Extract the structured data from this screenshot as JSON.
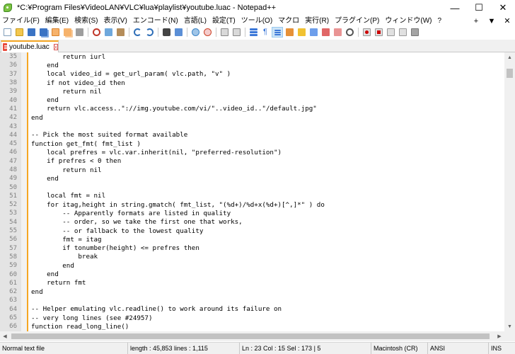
{
  "window": {
    "title": "*C:¥Program Files¥VideoLAN¥VLC¥lua¥playlist¥youtube.luac - Notepad++",
    "minimize_glyph": "—",
    "maximize_glyph": "☐",
    "close_glyph": "✕"
  },
  "menu": {
    "items": [
      "ファイル(F)",
      "編集(E)",
      "検索(S)",
      "表示(V)",
      "エンコード(N)",
      "言語(L)",
      "設定(T)",
      "ツール(O)",
      "マクロ",
      "実行(R)",
      "プラグイン(P)",
      "ウィンドウ(W)",
      "?"
    ],
    "right_plus": "+",
    "right_dropdown": "▼",
    "right_close": "✕"
  },
  "toolbar": {
    "icons": [
      "new-file-icon",
      "open-file-icon",
      "save-icon",
      "save-all-icon",
      "close-icon",
      "close-all-icon",
      "print-icon",
      "cut-icon",
      "copy-icon",
      "paste-icon",
      "undo-icon",
      "redo-icon",
      "find-icon",
      "replace-icon",
      "zoom-in-icon",
      "zoom-out-icon",
      "sync-vertical-icon",
      "sync-horizontal-icon",
      "word-wrap-icon",
      "show-all-chars-icon",
      "indent-guide-icon",
      "user-defined-language-icon",
      "doc-map-icon",
      "function-list-icon",
      "folder-as-workspace-icon",
      "doc-switcher-icon",
      "monitoring-icon",
      "record-macro-icon",
      "stop-record-icon",
      "play-macro-icon",
      "run-macro-multiple-icon",
      "save-macro-icon"
    ]
  },
  "tab": {
    "label": "youtube.luac",
    "close_glyph": "x"
  },
  "editor": {
    "lines": [
      {
        "n": "35",
        "t": "        return iurl"
      },
      {
        "n": "36",
        "t": "    end"
      },
      {
        "n": "37",
        "t": "    local video_id = get_url_param( vlc.path, \"v\" )"
      },
      {
        "n": "38",
        "t": "    if not video_id then"
      },
      {
        "n": "39",
        "t": "        return nil"
      },
      {
        "n": "40",
        "t": "    end"
      },
      {
        "n": "41",
        "t": "    return vlc.access..\"://img.youtube.com/vi/\"..video_id..\"/default.jpg\""
      },
      {
        "n": "42",
        "t": "end"
      },
      {
        "n": "43",
        "t": ""
      },
      {
        "n": "44",
        "t": "-- Pick the most suited format available"
      },
      {
        "n": "45",
        "t": "function get_fmt( fmt_list )"
      },
      {
        "n": "46",
        "t": "    local prefres = vlc.var.inherit(nil, \"preferred-resolution\")"
      },
      {
        "n": "47",
        "t": "    if prefres < 0 then"
      },
      {
        "n": "48",
        "t": "        return nil"
      },
      {
        "n": "49",
        "t": "    end"
      },
      {
        "n": "50",
        "t": ""
      },
      {
        "n": "51",
        "t": "    local fmt = nil"
      },
      {
        "n": "52",
        "t": "    for itag,height in string.gmatch( fmt_list, \"(%d+)/%d+x(%d+)[^,]*\" ) do"
      },
      {
        "n": "53",
        "t": "        -- Apparently formats are listed in quality"
      },
      {
        "n": "54",
        "t": "        -- order, so we take the first one that works,"
      },
      {
        "n": "55",
        "t": "        -- or fallback to the lowest quality"
      },
      {
        "n": "56",
        "t": "        fmt = itag"
      },
      {
        "n": "57",
        "t": "        if tonumber(height) <= prefres then"
      },
      {
        "n": "58",
        "t": "            break"
      },
      {
        "n": "59",
        "t": "        end"
      },
      {
        "n": "60",
        "t": "    end"
      },
      {
        "n": "61",
        "t": "    return fmt"
      },
      {
        "n": "62",
        "t": "end"
      },
      {
        "n": "63",
        "t": ""
      },
      {
        "n": "64",
        "t": "-- Helper emulating vlc.readline() to work around its failure on"
      },
      {
        "n": "65",
        "t": "-- very long lines (see #24957)"
      },
      {
        "n": "66",
        "t": "function read_long_line()"
      }
    ]
  },
  "scrollbars": {
    "up": "▲",
    "down": "▼",
    "left": "◀",
    "right": "▶"
  },
  "status": {
    "file_type": "Normal text file",
    "length": "length : 45,853    lines : 1,115",
    "position": "Ln : 23    Col : 15    Sel : 173 | 5",
    "eol": "Macintosh (CR)",
    "encoding": "ANSI",
    "mode": "INS"
  }
}
